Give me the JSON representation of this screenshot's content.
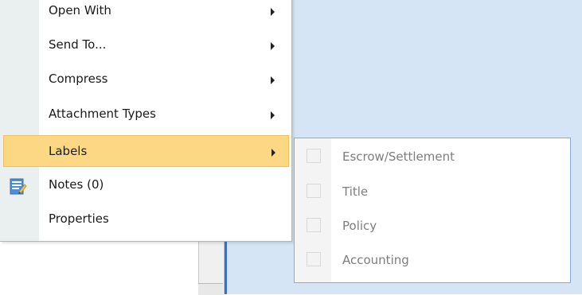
{
  "context_menu": {
    "items": [
      {
        "label": "Open With",
        "has_submenu": true
      },
      {
        "label": "Send To...",
        "has_submenu": true
      },
      {
        "label": "Compress",
        "has_submenu": true
      },
      {
        "label": "Attachment Types",
        "has_submenu": true
      },
      {
        "label": "Labels",
        "has_submenu": true,
        "highlighted": true
      },
      {
        "label": "Notes (0)",
        "icon": "notes-icon",
        "has_submenu": false
      },
      {
        "label": "Properties",
        "has_submenu": false
      }
    ]
  },
  "labels_submenu": {
    "items": [
      {
        "label": "Escrow/Settlement",
        "checked": false
      },
      {
        "label": "Title",
        "checked": false
      },
      {
        "label": "Policy",
        "checked": false
      },
      {
        "label": "Accounting",
        "checked": false
      }
    ]
  },
  "colors": {
    "highlight": "#fdd884",
    "highlight_border": "#f0c25c",
    "background_pane": "#d6e5f5",
    "submenu_border": "#8aaad6",
    "disabled_text": "#7d7d7d"
  }
}
